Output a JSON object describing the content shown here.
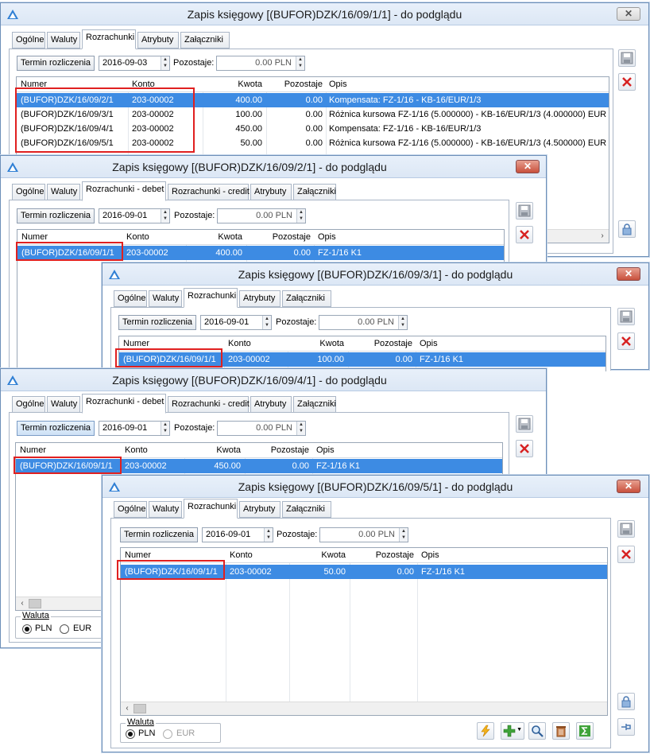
{
  "colors": {
    "selection": "#3d8be3",
    "highlight": "#e02020"
  },
  "win1": {
    "title": "Zapis księgowy [(BUFOR)DZK/16/09/1/1] - do podglądu",
    "close": "✕",
    "tabs": [
      "Ogólne",
      "Waluty",
      "Rozrachunki",
      "Atrybuty",
      "Załączniki"
    ],
    "termin": "Termin rozliczenia",
    "date": "2016-09-03",
    "pozostaje_label": "Pozostaje:",
    "pozostaje": "0.00 PLN",
    "cols": [
      "Numer",
      "Konto",
      "Kwota",
      "Pozostaje",
      "Opis"
    ],
    "rows": [
      [
        "(BUFOR)DZK/16/09/2/1",
        "203-00002",
        "400.00",
        "0.00",
        "Kompensata: FZ-1/16 - KB-16/EUR/1/3"
      ],
      [
        "(BUFOR)DZK/16/09/3/1",
        "203-00002",
        "100.00",
        "0.00",
        "Różnica kursowa FZ-1/16 (5.000000) - KB-16/EUR/1/3 (4.000000) EUR"
      ],
      [
        "(BUFOR)DZK/16/09/4/1",
        "203-00002",
        "450.00",
        "0.00",
        "Kompensata: FZ-1/16 - KB-16/EUR/1/3"
      ],
      [
        "(BUFOR)DZK/16/09/5/1",
        "203-00002",
        "50.00",
        "0.00",
        "Różnica kursowa FZ-1/16 (5.000000) - KB-16/EUR/1/3 (4.500000) EUR"
      ]
    ]
  },
  "win2": {
    "title": "Zapis księgowy [(BUFOR)DZK/16/09/2/1] - do podglądu",
    "tabs": [
      "Ogólne",
      "Waluty",
      "Rozrachunki - debet",
      "Rozrachunki - credit",
      "Atrybuty",
      "Załączniki"
    ],
    "termin": "Termin rozliczenia",
    "date": "2016-09-01",
    "pozostaje_label": "Pozostaje:",
    "pozostaje": "0.00 PLN",
    "cols": [
      "Numer",
      "Konto",
      "Kwota",
      "Pozostaje",
      "Opis"
    ],
    "row": [
      "(BUFOR)DZK/16/09/1/1",
      "203-00002",
      "400.00",
      "0.00",
      "FZ-1/16 K1"
    ]
  },
  "win3": {
    "title": "Zapis księgowy [(BUFOR)DZK/16/09/3/1] - do podglądu",
    "tabs": [
      "Ogólne",
      "Waluty",
      "Rozrachunki",
      "Atrybuty",
      "Załączniki"
    ],
    "termin": "Termin rozliczenia",
    "date": "2016-09-01",
    "pozostaje_label": "Pozostaje:",
    "pozostaje": "0.00 PLN",
    "cols": [
      "Numer",
      "Konto",
      "Kwota",
      "Pozostaje",
      "Opis"
    ],
    "row": [
      "(BUFOR)DZK/16/09/1/1",
      "203-00002",
      "100.00",
      "0.00",
      "FZ-1/16 K1"
    ]
  },
  "win4": {
    "title": "Zapis księgowy [(BUFOR)DZK/16/09/4/1] - do podglądu",
    "tabs": [
      "Ogólne",
      "Waluty",
      "Rozrachunki - debet",
      "Rozrachunki - credit",
      "Atrybuty",
      "Załączniki"
    ],
    "termin": "Termin rozliczenia",
    "date": "2016-09-01",
    "pozostaje_label": "Pozostaje:",
    "pozostaje": "0.00 PLN",
    "cols": [
      "Numer",
      "Konto",
      "Kwota",
      "Pozostaje",
      "Opis"
    ],
    "row": [
      "(BUFOR)DZK/16/09/1/1",
      "203-00002",
      "450.00",
      "0.00",
      "FZ-1/16 K1"
    ],
    "waluta": "Waluta",
    "pln": "PLN",
    "eur": "EUR"
  },
  "win5": {
    "title": "Zapis księgowy [(BUFOR)DZK/16/09/5/1] - do podglądu",
    "tabs": [
      "Ogólne",
      "Waluty",
      "Rozrachunki",
      "Atrybuty",
      "Załączniki"
    ],
    "termin": "Termin rozliczenia",
    "date": "2016-09-01",
    "pozostaje_label": "Pozostaje:",
    "pozostaje": "0.00 PLN",
    "cols": [
      "Numer",
      "Konto",
      "Kwota",
      "Pozostaje",
      "Opis"
    ],
    "row": [
      "(BUFOR)DZK/16/09/1/1",
      "203-00002",
      "50.00",
      "0.00",
      "FZ-1/16 K1"
    ],
    "waluta": "Waluta",
    "pln": "PLN",
    "eur": "EUR"
  }
}
